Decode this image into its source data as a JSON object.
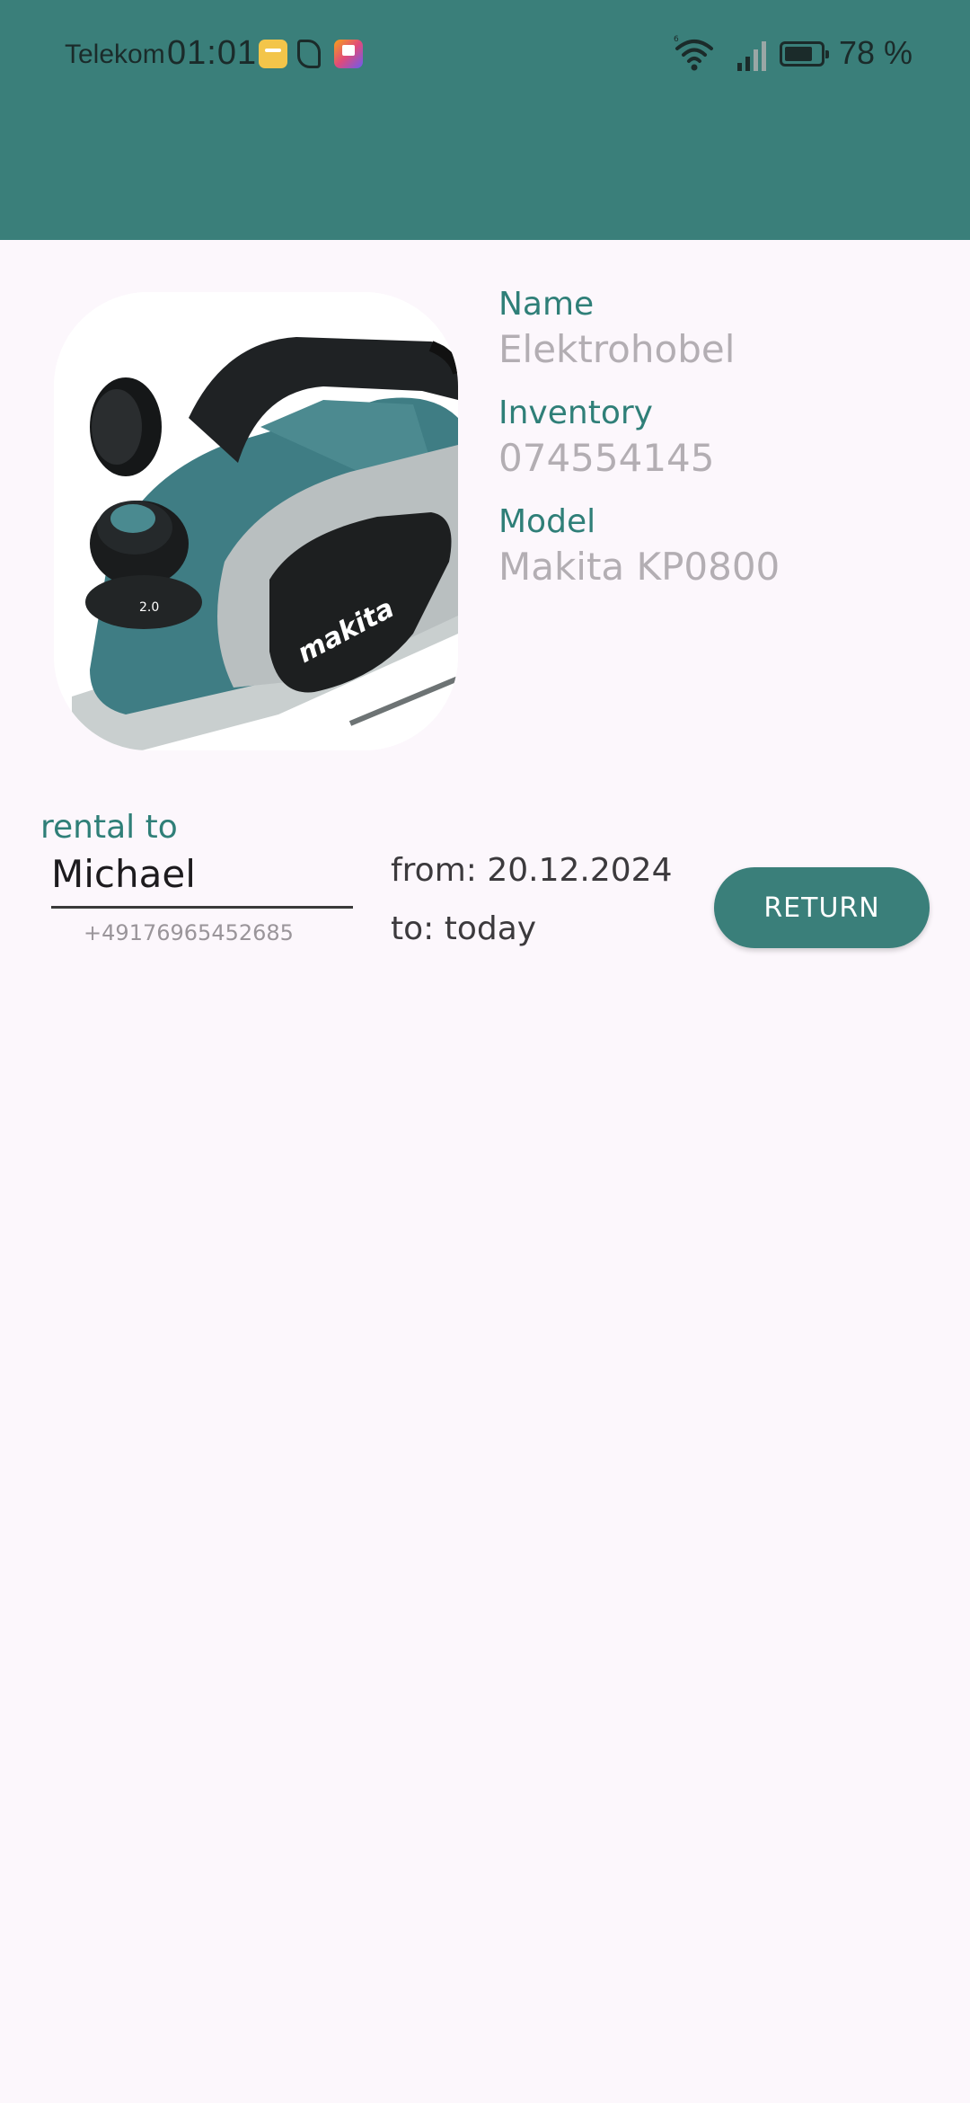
{
  "status_bar": {
    "carrier": "Telekom",
    "time": "01:01",
    "battery_percent": "78 %",
    "battery_level": 0.78,
    "notification_icons": [
      "mail-notification-icon",
      "leaf-app-icon",
      "paint-app-icon"
    ]
  },
  "colors": {
    "header": "#3a7f7a",
    "accent": "#2f7f78",
    "background": "#fcf7fc",
    "muted_value": "#b3aeb3"
  },
  "item": {
    "image_icon": "electric-planer-photo",
    "name_label": "Name",
    "name_value": "Elektrohobel",
    "inventory_label": "Inventory",
    "inventory_value": "074554145",
    "model_label": "Model",
    "model_value": "Makita KP0800"
  },
  "rental": {
    "label": "rental to",
    "renter_name": "Michael",
    "renter_phone": "+49176965452685",
    "from_text": "from: 20.12.2024",
    "to_text": "to: today",
    "return_button": "RETURN"
  }
}
